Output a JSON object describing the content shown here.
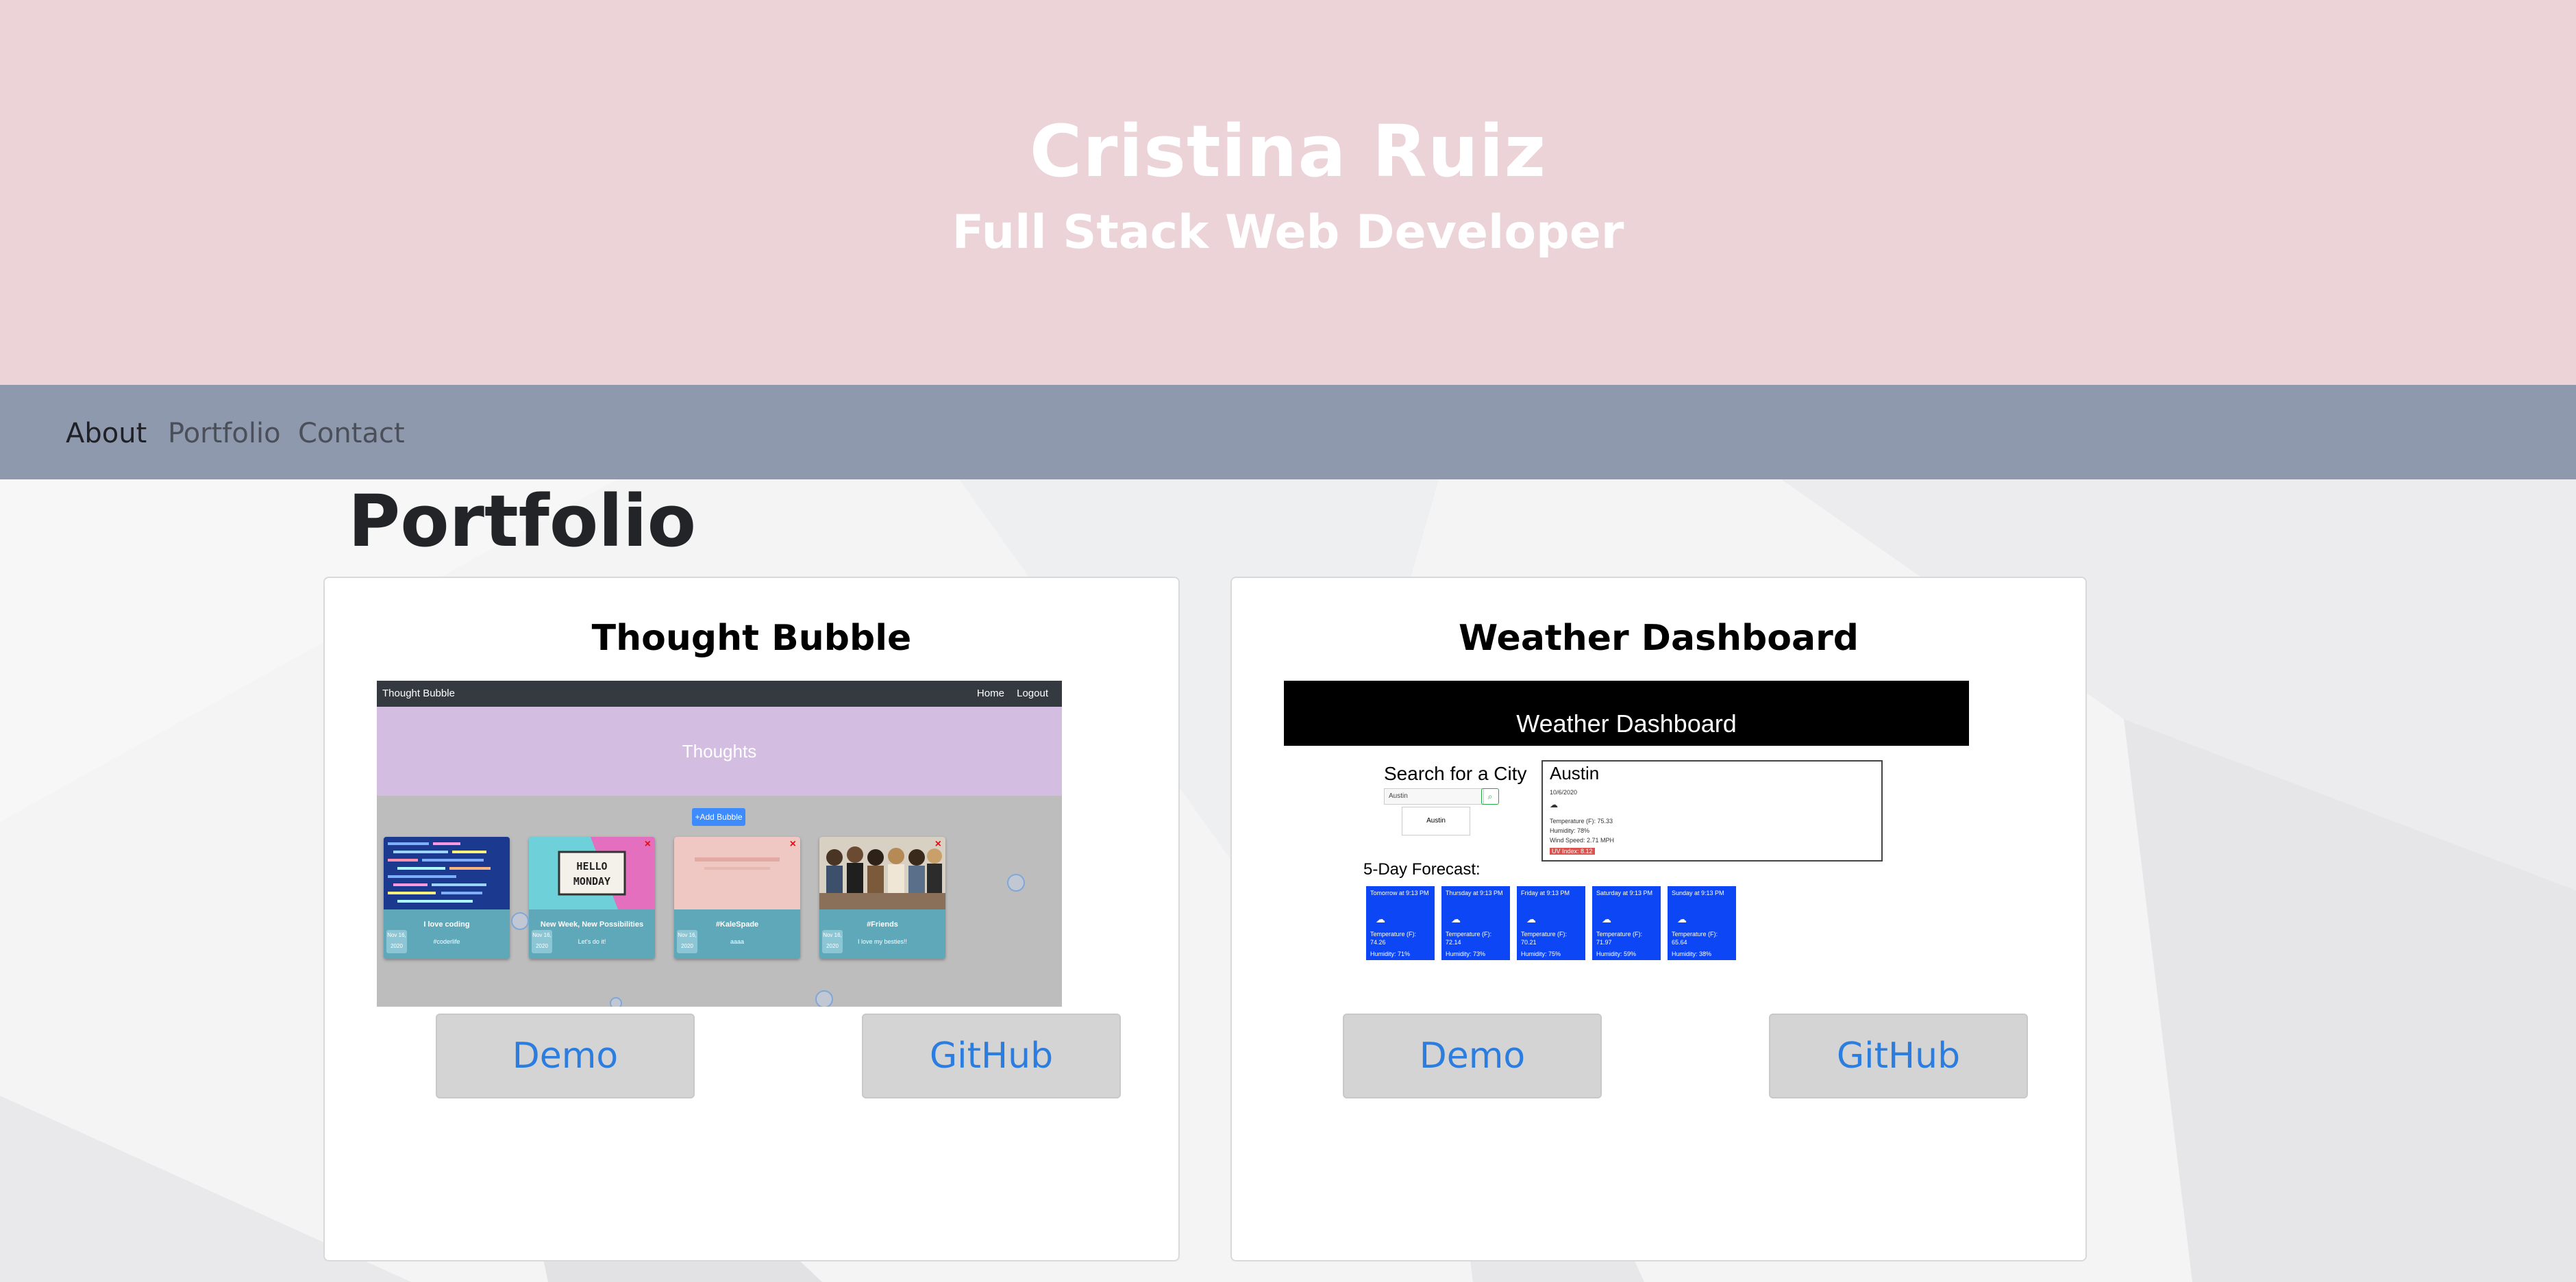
{
  "header": {
    "name": "Cristina Ruiz",
    "title": "Full Stack Web Developer"
  },
  "nav": {
    "items": [
      {
        "label": "About",
        "active": true
      },
      {
        "label": "Portfolio",
        "active": false
      },
      {
        "label": "Contact",
        "active": false
      }
    ]
  },
  "portfolio": {
    "title": "Portfolio",
    "projects": [
      {
        "title": "Thought Bubble",
        "demo_label": "Demo",
        "github_label": "GitHub",
        "screenshot": {
          "brand": "Thought Bubble",
          "links": [
            "Home",
            "Logout"
          ],
          "hero": "Thoughts",
          "add_button": "+Add Bubble",
          "cards": [
            {
              "caption": "I love coding",
              "sub": "#coderlife",
              "date": "Nov 16, 2020"
            },
            {
              "caption": "New Week, New Possibilities",
              "sub": "Let's do it!",
              "image_text": "HELLO MONDAY",
              "date": "Nov 16, 2020"
            },
            {
              "caption": "#KaleSpade",
              "sub": "aaaa",
              "date": "Nov 16, 2020"
            },
            {
              "caption": "#Friends",
              "sub": "I love my besties!!",
              "date": "Nov 16, 2020"
            }
          ]
        }
      },
      {
        "title": "Weather Dashboard",
        "demo_label": "Demo",
        "github_label": "GitHub",
        "screenshot": {
          "header": "Weather Dashboard",
          "search_title": "Search for a City",
          "search_value": "Austin",
          "city_button": "Austin",
          "current": {
            "city": "Austin",
            "date": "10/6/2020",
            "temperature": "Temperature (F): 75.33",
            "humidity": "Humidity: 78%",
            "wind": "Wind Speed: 2.71 MPH",
            "uv": "UV Index: 8.12"
          },
          "forecast_title": "5-Day Forecast:",
          "forecast": [
            {
              "when": "Tomorrow at 9:13 PM",
              "temp": "Temperature (F): 74.26",
              "humidity": "Humidity: 71%"
            },
            {
              "when": "Thursday at 9:13 PM",
              "temp": "Temperature (F): 72.14",
              "humidity": "Humidity: 73%"
            },
            {
              "when": "Friday at 9:13 PM",
              "temp": "Temperature (F): 70.21",
              "humidity": "Humidity: 75%"
            },
            {
              "when": "Saturday at 9:13 PM",
              "temp": "Temperature (F): 71.97",
              "humidity": "Humidity: 59%"
            },
            {
              "when": "Sunday at 9:13 PM",
              "temp": "Temperature (F): 65.64",
              "humidity": "Humidity: 38%"
            }
          ]
        }
      }
    ]
  }
}
